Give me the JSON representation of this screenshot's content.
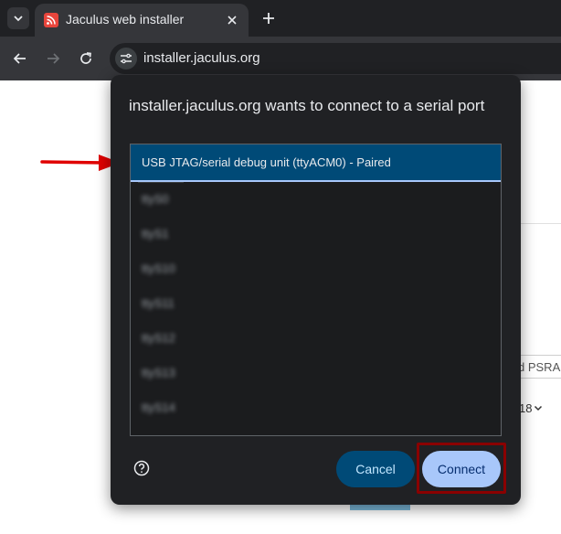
{
  "browser": {
    "tab": {
      "title": "Jaculus web installer",
      "favicon_icon": "rss-feed-icon",
      "close_label": "✕"
    },
    "new_tab_label": "+",
    "url": "installer.jaculus.org",
    "icons": [
      "tab-search-icon",
      "back-icon",
      "forward-icon",
      "reload-icon",
      "site-settings-icon"
    ]
  },
  "page": {
    "partial_field_text": "d PSRA",
    "partial_select_text": "18"
  },
  "dialog": {
    "title": "installer.jaculus.org wants to connect to a serial port",
    "devices": [
      {
        "label": "USB JTAG/serial debug unit (ttyACM0) - Paired",
        "selected": true
      },
      {
        "label": "ttyS0",
        "redacted": true
      },
      {
        "label": "ttyS1",
        "redacted": true
      },
      {
        "label": "ttyS10",
        "redacted": true
      },
      {
        "label": "ttyS11",
        "redacted": true
      },
      {
        "label": "ttyS12",
        "redacted": true
      },
      {
        "label": "ttyS13",
        "redacted": true
      },
      {
        "label": "ttyS14",
        "redacted": true
      }
    ],
    "help_icon": "help-circle-icon",
    "cancel_label": "Cancel",
    "connect_label": "Connect"
  },
  "colors": {
    "dialog_bg": "#202124",
    "selected_row": "#004a77",
    "connect_button": "#a8c7fa",
    "annotation_red": "#e00000",
    "highlight_box": "#8a0000"
  }
}
